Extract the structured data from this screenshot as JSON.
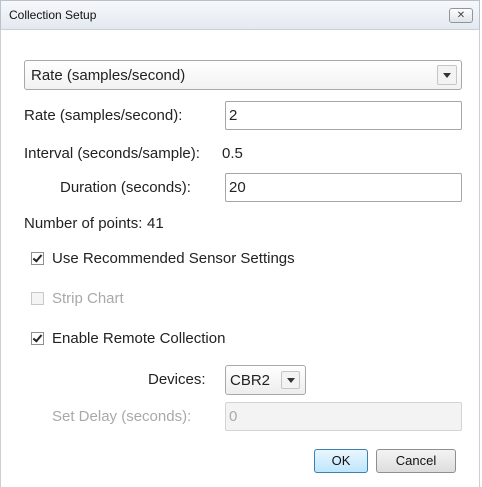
{
  "window": {
    "title": "Collection Setup",
    "close_glyph": "✕"
  },
  "mode_select": {
    "value": "Rate (samples/second)"
  },
  "rate": {
    "label": "Rate (samples/second):",
    "value": "2"
  },
  "interval": {
    "label": "Interval (seconds/sample):",
    "value": "0.5"
  },
  "duration": {
    "label": "Duration (seconds):",
    "value": "20"
  },
  "points": {
    "label": "Number of points:",
    "value": "41"
  },
  "checkboxes": [
    {
      "label": "Use Recommended Sensor Settings",
      "checked": true,
      "enabled": true
    },
    {
      "label": "Strip Chart",
      "checked": false,
      "enabled": false
    },
    {
      "label": "Enable Remote Collection",
      "checked": true,
      "enabled": true
    }
  ],
  "devices": {
    "label": "Devices:",
    "value": "CBR2"
  },
  "delay": {
    "label": "Set Delay (seconds):",
    "value": "0"
  },
  "buttons": {
    "ok": "OK",
    "cancel": "Cancel"
  }
}
